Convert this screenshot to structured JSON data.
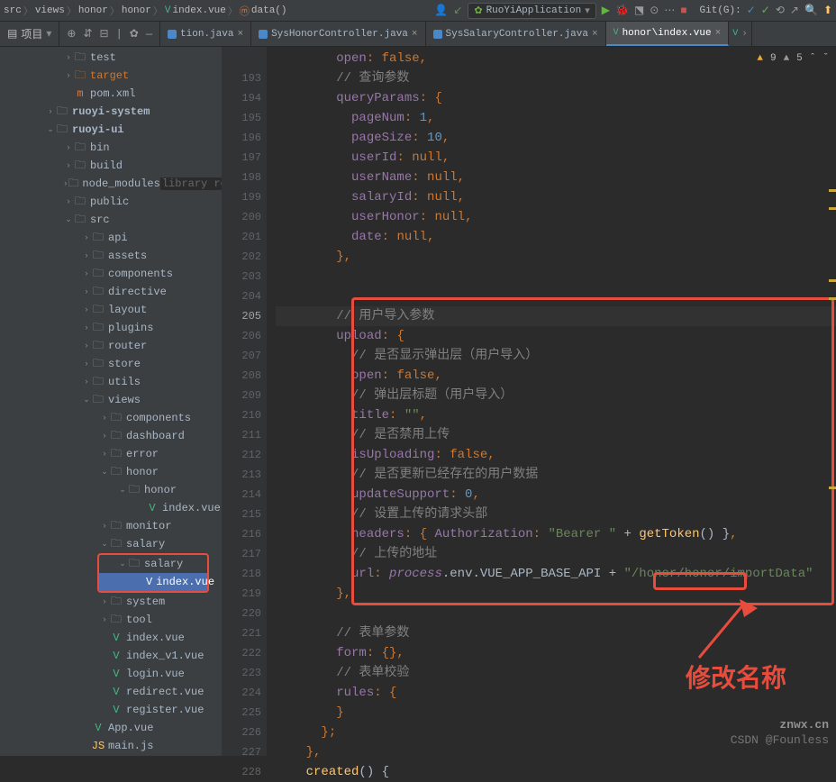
{
  "breadcrumb": [
    "src",
    "views",
    "honor",
    "honor",
    "index.vue",
    "data()"
  ],
  "run_config": "RuoYiApplication",
  "git_label": "Git(G):",
  "tabs": {
    "t0": "tion.java",
    "t1": "SysHonorController.java",
    "t2": "SysSalaryController.java",
    "t3": "honor\\index.vue"
  },
  "project_label": "项目",
  "side_tab": "项目",
  "tree": {
    "test": "test",
    "target": "target",
    "pom": "pom.xml",
    "ruoyi_system": "ruoyi-system",
    "ruoyi_ui": "ruoyi-ui",
    "bin": "bin",
    "build": "build",
    "node_modules": "node_modules",
    "node_modules_tag": "library root",
    "public": "public",
    "src": "src",
    "api": "api",
    "assets": "assets",
    "components": "components",
    "directive": "directive",
    "layout": "layout",
    "plugins": "plugins",
    "router": "router",
    "store": "store",
    "utils": "utils",
    "views": "views",
    "components2": "components",
    "dashboard": "dashboard",
    "error": "error",
    "honor": "honor",
    "honor2": "honor",
    "index_vue": "index.vue",
    "monitor": "monitor",
    "salary": "salary",
    "salary2": "salary",
    "index_vue2": "index.vue",
    "system": "system",
    "tool": "tool",
    "index_vue3": "index.vue",
    "index_v1": "index_v1.vue",
    "login": "login.vue",
    "redirect": "redirect.vue",
    "register": "register.vue",
    "app_vue": "App.vue",
    "main_js": "main.js"
  },
  "lines": {
    "l193": "// 查询参数",
    "l194_a": "queryParams",
    "l194_b": ": {",
    "l195_a": "pageNum",
    "l195_b": "1",
    "l196_a": "pageSize",
    "l196_b": "10",
    "l197_a": "userId",
    "l197_b": "null",
    "l198_a": "userName",
    "l198_b": "null",
    "l199_a": "salaryId",
    "l199_b": "null",
    "l200_a": "userHonor",
    "l200_b": "null",
    "l201_a": "date",
    "l201_b": "null",
    "l205": "// 用户导入参数",
    "l206_a": "upload",
    "l206_b": ": {",
    "l207": "// 是否显示弹出层（用户导入）",
    "l208_a": "open",
    "l208_b": "false",
    "l209": "// 弹出层标题（用户导入）",
    "l210_a": "title",
    "l210_b": "\"\"",
    "l211": "// 是否禁用上传",
    "l212_a": "isUploading",
    "l212_b": "false",
    "l213": "// 是否更新已经存在的用户数据",
    "l214_a": "updateSupport",
    "l214_b": "0",
    "l215": "// 设置上传的请求头部",
    "l216_a": "headers",
    "l216_b": "Authorization",
    "l216_c": "\"Bearer \"",
    "l216_d": "getToken",
    "l217": "// 上传的地址",
    "l218_a": "url",
    "l218_b": "process",
    "l218_c": ".env.VUE_APP_BASE_API + ",
    "l218_d": "\"",
    "l218_e": "/honor/honor/",
    "l218_f": "importData",
    "l218_g": "\"",
    "l221": "// 表单参数",
    "l222_a": "form",
    "l222_b": ": {},",
    "l223": "// 表单校验",
    "l224_a": "rules",
    "l224_b": ": {",
    "l228_a": "created",
    "l228_b": "() {"
  },
  "status": {
    "warn": "9",
    "weak": "5"
  },
  "annotation": "修改名称",
  "watermark": {
    "brand": "znwx.cn",
    "credit": "CSDN @Founless"
  }
}
